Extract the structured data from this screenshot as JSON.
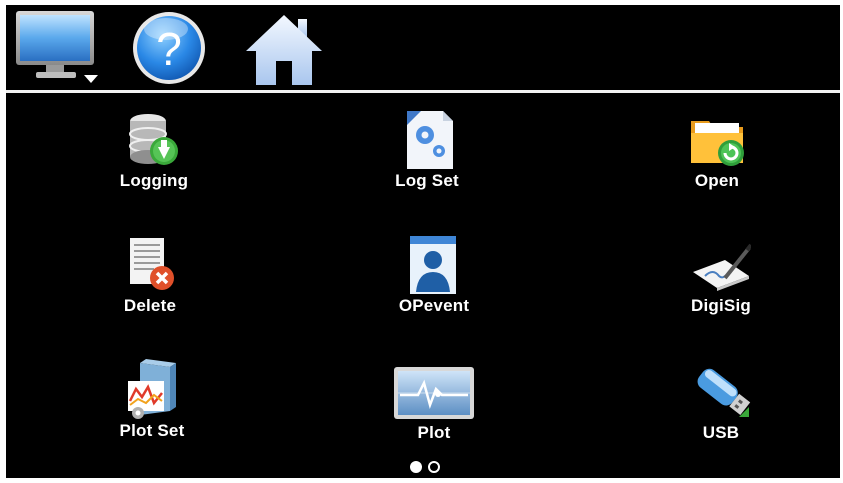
{
  "toolbar": {
    "icons": [
      "monitor-icon",
      "help-icon",
      "home-icon"
    ]
  },
  "menu": {
    "items": [
      {
        "label": "Logging",
        "icon": "database-download-icon"
      },
      {
        "label": "Log Set",
        "icon": "settings-document-icon"
      },
      {
        "label": "Open",
        "icon": "folder-open-icon"
      },
      {
        "label": "Delete",
        "icon": "document-delete-icon"
      },
      {
        "label": "OPevent",
        "icon": "user-badge-icon"
      },
      {
        "label": "DigiSig",
        "icon": "signature-icon"
      },
      {
        "label": "Plot Set",
        "icon": "plot-settings-icon"
      },
      {
        "label": "Plot",
        "icon": "plot-chart-icon"
      },
      {
        "label": "USB",
        "icon": "usb-drive-icon"
      }
    ]
  },
  "pagination": {
    "current": 1,
    "total": 2
  },
  "colors": {
    "background": "#000000",
    "divider": "#f2f2f2",
    "label": "#ffffff",
    "accent_green": "#3aa83a"
  }
}
